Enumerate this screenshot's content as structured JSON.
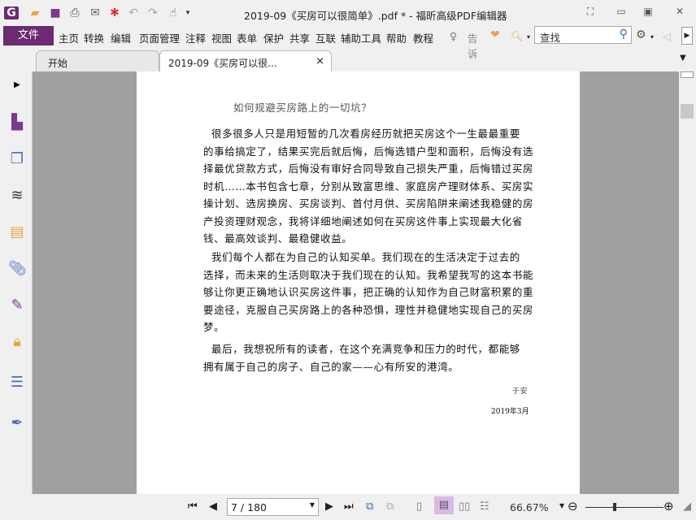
{
  "title": "2019-09《买房可以很简单》.pdf * - 福昕高级PDF编辑器",
  "menu": {
    "file": "文件",
    "items": [
      "主页",
      "转换",
      "编辑",
      "页面管理",
      "注释",
      "视图",
      "表单",
      "保护",
      "共享",
      "互联",
      "辅助工具",
      "帮助",
      "教程"
    ],
    "tell": "告诉",
    "search_placeholder": "查找"
  },
  "tabs": [
    {
      "label": "开始"
    },
    {
      "label": "2019-09《买房可以很...",
      "close": "×"
    }
  ],
  "document": {
    "heading": "如何规避买房路上的一切坑？",
    "p1": [
      "很多很多人只是用短暂的几次看房经历就把买房这个一生最最重要",
      "的事给搞定了，结果买完后就后悔，后悔选错户型和面积，后悔没有选",
      "择最优贷款方式，后悔没有审好合同导致自己损失严重，后悔错过买房",
      "时机……本书包含七章，分别从致富思维、家庭房产理财体系、买房实",
      "操计划、选房换房、买房谈判、首付月供、买房陷阱来阐述我稳健的房",
      "产投资理财观念，我将详细地阐述如何在买房这件事上实现最大化省",
      "钱、最高效谈判、最稳健收益。"
    ],
    "p2": [
      "我们每个人都在为自己的认知买单。我们现在的生活决定于过去的",
      "选择，而未来的生活则取决于我们现在的认知。我希望我写的这本书能",
      "够让你更正确地认识买房这件事，把正确的认知作为自己财富积累的重",
      "要途径，克服自己买房路上的各种恐惧，理性并稳健地实现自己的买房",
      "梦。"
    ],
    "p3": [
      "最后，我想祝所有的读者，在这个充满竞争和压力的时代，都能够",
      "拥有属于自己的房子、自己的家——心有所安的港湾。"
    ],
    "signature": "于安",
    "date": "2019年3月"
  },
  "status": {
    "page": "7 / 180",
    "zoom": "66.67%",
    "zoom_slider_fraction": 0.38
  },
  "colors": {
    "brand": "#6b2a72"
  }
}
